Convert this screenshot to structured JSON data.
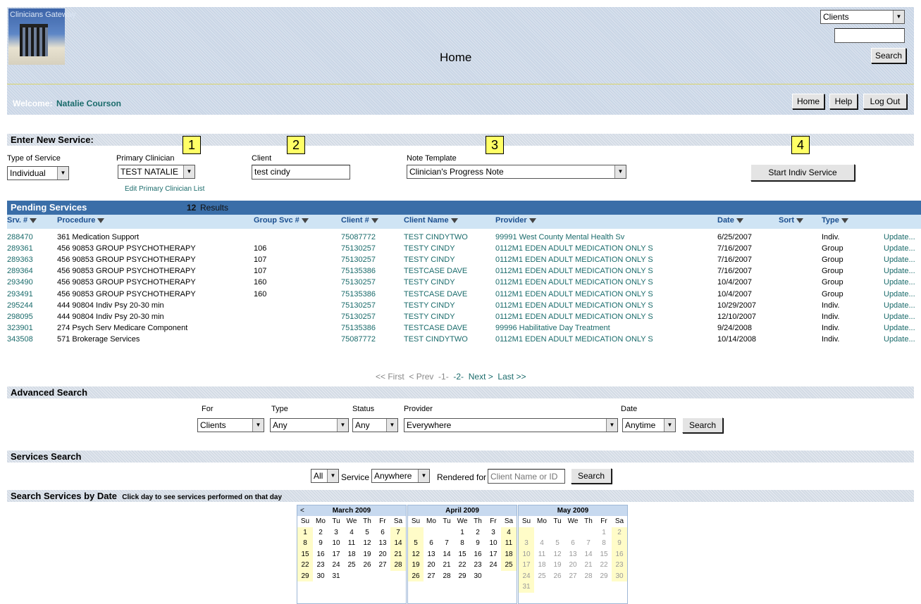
{
  "header": {
    "logo_text": "Clinicians Gateway",
    "title": "Home",
    "search_scope": "Clients",
    "search_button": "Search",
    "welcome_label": "Welcome:",
    "user_name": "Natalie Courson",
    "nav": [
      "Home",
      "Help",
      "Log Out"
    ]
  },
  "new_service": {
    "title": "Enter New Service:",
    "type_label": "Type of Service",
    "type_value": "Individual",
    "clinician_label": "Primary Clinician",
    "clinician_value": "TEST NATALIE",
    "edit_link": "Edit Primary Clinician List",
    "client_label": "Client",
    "client_value": "test cindy",
    "template_label": "Note Template",
    "template_value": "Clinician's Progress Note",
    "start_button": "Start Indiv Service",
    "callouts": [
      "1",
      "2",
      "3",
      "4"
    ]
  },
  "pending": {
    "title": "Pending Services",
    "count": "12",
    "count_label": "Results",
    "columns": [
      "Srv. #",
      "Procedure",
      "Group Svc #",
      "Client #",
      "Client Name",
      "Provider",
      "Date",
      "Sort",
      "Type"
    ],
    "rows": [
      {
        "srv": "288470",
        "proc": "361 Medication Support",
        "grp": "",
        "client": "75087772",
        "name": "TEST CINDYTWO",
        "provider": "99991 West County Mental Health Sv",
        "date": "6/25/2007",
        "type": "Indiv.",
        "action": "Update..."
      },
      {
        "srv": "289361",
        "proc": "456 90853 GROUP PSYCHOTHERAPY",
        "grp": "106",
        "client": "75130257",
        "name": "TESTY CINDY",
        "provider": "0112M1 EDEN ADULT MEDICATION ONLY S",
        "date": "7/16/2007",
        "type": "Group",
        "action": "Update..."
      },
      {
        "srv": "289363",
        "proc": "456 90853 GROUP PSYCHOTHERAPY",
        "grp": "107",
        "client": "75130257",
        "name": "TESTY CINDY",
        "provider": "0112M1 EDEN ADULT MEDICATION ONLY S",
        "date": "7/16/2007",
        "type": "Group",
        "action": "Update..."
      },
      {
        "srv": "289364",
        "proc": "456 90853 GROUP PSYCHOTHERAPY",
        "grp": "107",
        "client": "75135386",
        "name": "TESTCASE DAVE",
        "provider": "0112M1 EDEN ADULT MEDICATION ONLY S",
        "date": "7/16/2007",
        "type": "Group",
        "action": "Update..."
      },
      {
        "srv": "293490",
        "proc": "456 90853 GROUP PSYCHOTHERAPY",
        "grp": "160",
        "client": "75130257",
        "name": "TESTY CINDY",
        "provider": "0112M1 EDEN ADULT MEDICATION ONLY S",
        "date": "10/4/2007",
        "type": "Group",
        "action": "Update..."
      },
      {
        "srv": "293491",
        "proc": "456 90853 GROUP PSYCHOTHERAPY",
        "grp": "160",
        "client": "75135386",
        "name": "TESTCASE DAVE",
        "provider": "0112M1 EDEN ADULT MEDICATION ONLY S",
        "date": "10/4/2007",
        "type": "Group",
        "action": "Update..."
      },
      {
        "srv": "295244",
        "proc": "444 90804 Indiv Psy 20-30 min",
        "grp": "",
        "client": "75130257",
        "name": "TESTY CINDY",
        "provider": "0112M1 EDEN ADULT MEDICATION ONLY S",
        "date": "10/29/2007",
        "type": "Indiv.",
        "action": "Update..."
      },
      {
        "srv": "298095",
        "proc": "444 90804 Indiv Psy 20-30 min",
        "grp": "",
        "client": "75130257",
        "name": "TESTY CINDY",
        "provider": "0112M1 EDEN ADULT MEDICATION ONLY S",
        "date": "12/10/2007",
        "type": "Indiv.",
        "action": "Update..."
      },
      {
        "srv": "323901",
        "proc": "274 Psych Serv Medicare Component",
        "grp": "",
        "client": "75135386",
        "name": "TESTCASE DAVE",
        "provider": "99996 Habilitative Day Treatment",
        "date": "9/24/2008",
        "type": "Indiv.",
        "action": "Update..."
      },
      {
        "srv": "343508",
        "proc": "571 Brokerage Services",
        "grp": "",
        "client": "75087772",
        "name": "TEST CINDYTWO",
        "provider": "0112M1 EDEN ADULT MEDICATION ONLY S",
        "date": "10/14/2008",
        "type": "Indiv.",
        "action": "Update..."
      }
    ],
    "pager": {
      "first": "<< First",
      "prev": "< Prev",
      "p1": "-1-",
      "p2": "-2-",
      "next": "Next >",
      "last": "Last >>"
    }
  },
  "advanced": {
    "title": "Advanced Search",
    "for_label": "For",
    "for_value": "Clients",
    "type_label": "Type",
    "type_value": "Any",
    "status_label": "Status",
    "status_value": "Any",
    "provider_label": "Provider",
    "provider_value": "Everywhere",
    "date_label": "Date",
    "date_value": "Anytime",
    "button": "Search"
  },
  "services_search": {
    "title": "Services Search",
    "scope": "All",
    "service_label": "Service",
    "service_value": "Anywhere",
    "rendered_label": "Rendered for",
    "placeholder": "Client Name or ID",
    "button": "Search"
  },
  "by_date": {
    "title": "Search Services by Date",
    "hint": "Click day to see services performed on that day",
    "prev": "<",
    "days": [
      "Su",
      "Mo",
      "Tu",
      "We",
      "Th",
      "Fr",
      "Sa"
    ],
    "months": [
      {
        "name": "March 2009",
        "offset": 0,
        "count": 31,
        "dim": false
      },
      {
        "name": "April 2009",
        "offset": 3,
        "count": 30,
        "dim": false
      },
      {
        "name": "May 2009",
        "offset": 5,
        "count": 31,
        "dim": true
      }
    ]
  }
}
